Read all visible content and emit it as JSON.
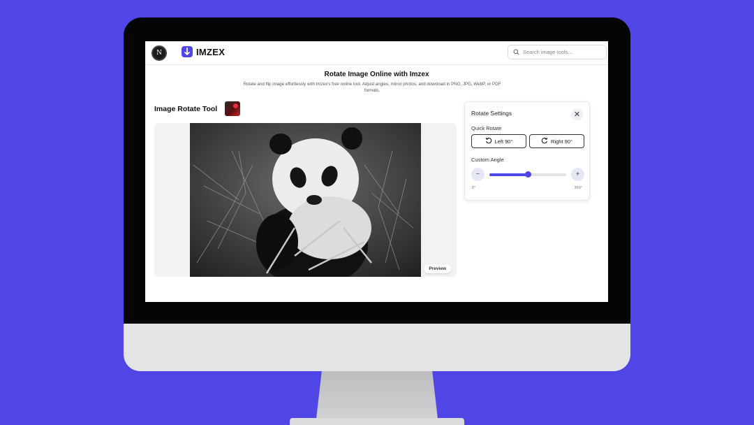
{
  "app": {
    "avatar_letter": "N",
    "logo_text": "IMZEX",
    "search_placeholder": "Search image tools..."
  },
  "page": {
    "title": "Rotate Image Online with Imzex",
    "description": "Rotate and flip image effortlessly with Imzex's free online tool. Adjust angles, mirror photos, and download in PNG, JPG, WebP, or PDF formats."
  },
  "tool": {
    "heading": "Image Rotate Tool",
    "preview_label": "Preview"
  },
  "settings": {
    "title": "Rotate Settings",
    "close_symbol": "✕",
    "quick_rotate_label": "Quick Rotate",
    "left_button": "Left 90°",
    "right_button": "Right 90°",
    "custom_angle_label": "Custom Angle",
    "minus_symbol": "−",
    "plus_symbol": "+",
    "range_min": "0°",
    "range_max": "360°",
    "slider_fraction": 0.5
  },
  "colors": {
    "background": "#4f46e5",
    "accent": "#4f46e5"
  },
  "icons": [
    "search-icon",
    "logo-download-icon",
    "close-icon",
    "rotate-left-icon",
    "rotate-right-icon",
    "minus-icon",
    "plus-icon"
  ]
}
